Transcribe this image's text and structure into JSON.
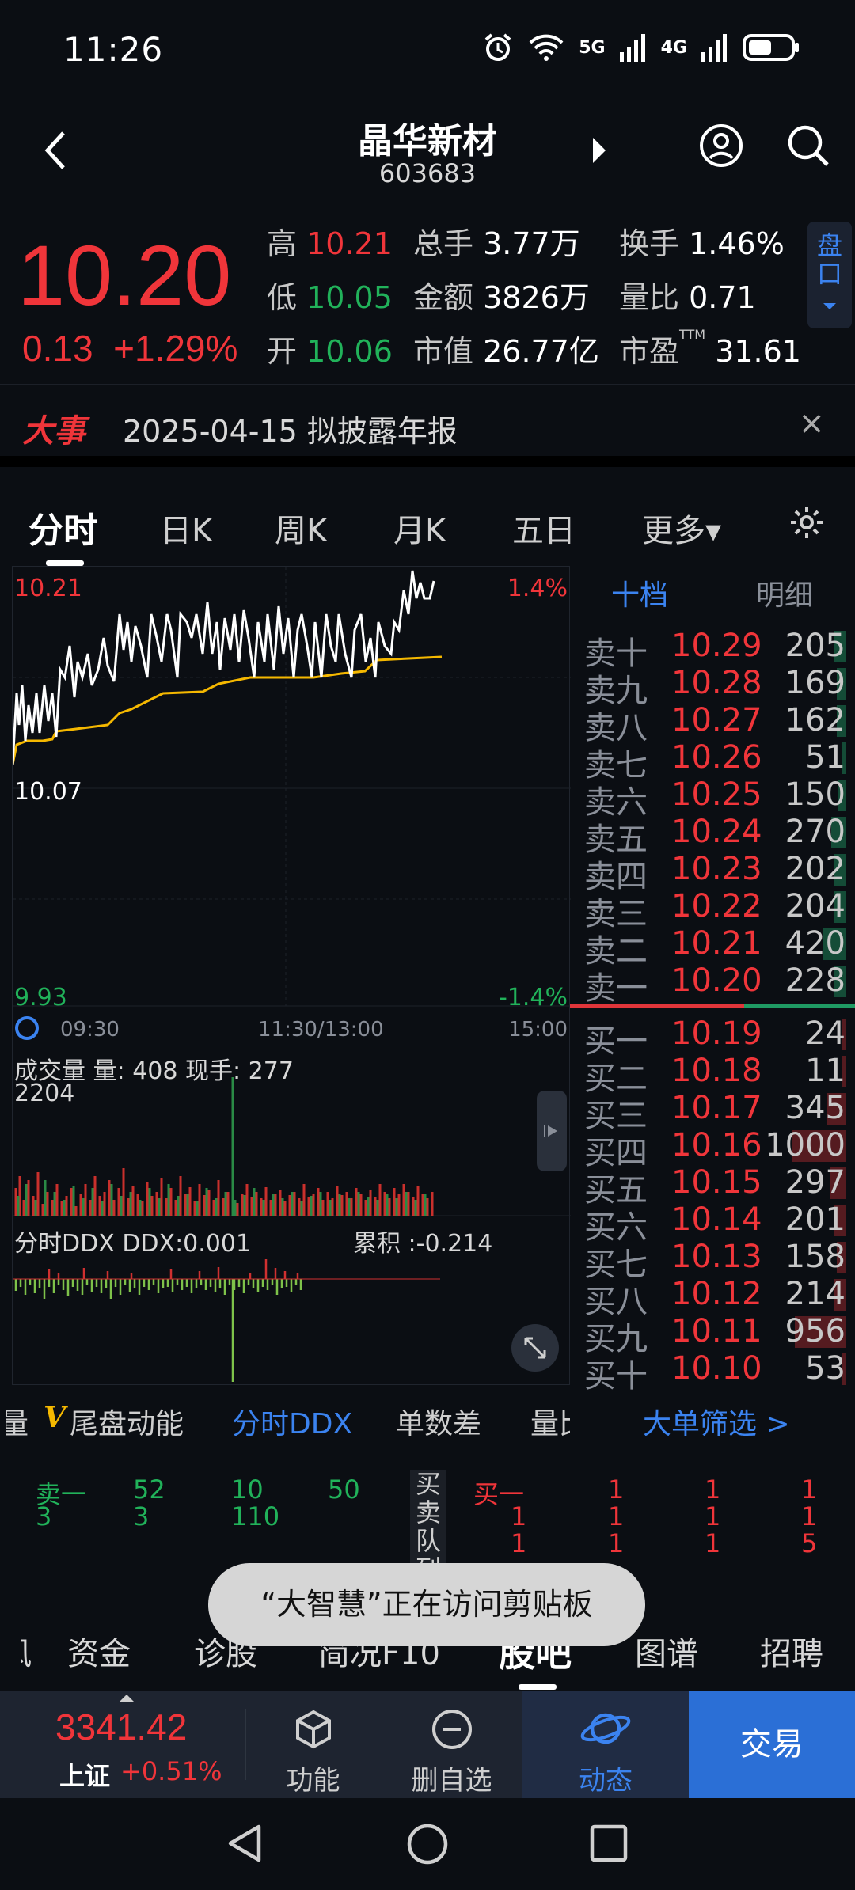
{
  "status_bar": {
    "time": "11:26",
    "signal1": "5G",
    "signal2": "4G"
  },
  "header": {
    "name": "晶华新材",
    "code": "603683"
  },
  "quote": {
    "price": "10.20",
    "change": "0.13",
    "change_pct": "+1.29%",
    "high_label": "高",
    "high": "10.21",
    "low_label": "低",
    "low": "10.05",
    "open_label": "开",
    "open": "10.06",
    "vol_label": "总手",
    "vol": "3.77万",
    "amt_label": "金额",
    "amt": "3826万",
    "cap_label": "市值",
    "cap": "26.77亿",
    "turnover_label": "换手",
    "turnover": "1.46%",
    "ratio_label": "量比",
    "ratio": "0.71",
    "pe_label": "市盈",
    "pe_sup": "TTM",
    "pe": "31.61",
    "pankou": "盘口"
  },
  "news": {
    "tag": "大事",
    "text": "2025-04-15 拟披露年报",
    "close": "×"
  },
  "chart_tabs": [
    {
      "label": "分时"
    },
    {
      "label": "日K"
    },
    {
      "label": "周K"
    },
    {
      "label": "月K"
    },
    {
      "label": "五日"
    },
    {
      "label": "更多▾"
    }
  ],
  "chart": {
    "price_hi": "10.21",
    "price_mid": "10.07",
    "price_lo": "9.93",
    "pct_hi": "1.4%",
    "pct_lo": "-1.4%",
    "time_start": "09:30",
    "time_mid": "11:30/13:00",
    "time_end": "15:00",
    "vol_title": "成交量",
    "vol_amt": "量: 408",
    "vol_now": "现手: 277",
    "vol_max": "2204",
    "ddx_title": "分时DDX",
    "ddx_val": "DDX:0.001",
    "ddx_cum": "累积 :-0.214"
  },
  "orderbook": {
    "tab_active": "十档",
    "tab_other": "明细",
    "asks": [
      {
        "label": "卖十",
        "price": "10.29",
        "vol": "205",
        "frac": 0.1
      },
      {
        "label": "卖九",
        "price": "10.28",
        "vol": "169",
        "frac": 0.08
      },
      {
        "label": "卖八",
        "price": "10.27",
        "vol": "162",
        "frac": 0.08
      },
      {
        "label": "卖七",
        "price": "10.26",
        "vol": "51",
        "frac": 0.03
      },
      {
        "label": "卖六",
        "price": "10.25",
        "vol": "150",
        "frac": 0.07
      },
      {
        "label": "卖五",
        "price": "10.24",
        "vol": "270",
        "frac": 0.13
      },
      {
        "label": "卖四",
        "price": "10.23",
        "vol": "202",
        "frac": 0.1
      },
      {
        "label": "卖三",
        "price": "10.22",
        "vol": "204",
        "frac": 0.1
      },
      {
        "label": "卖二",
        "price": "10.21",
        "vol": "420",
        "frac": 0.2
      },
      {
        "label": "卖一",
        "price": "10.20",
        "vol": "228",
        "frac": 0.11
      }
    ],
    "bids": [
      {
        "label": "买一",
        "price": "10.19",
        "vol": "24",
        "frac": 0.02
      },
      {
        "label": "买二",
        "price": "10.18",
        "vol": "11",
        "frac": 0.01
      },
      {
        "label": "买三",
        "price": "10.17",
        "vol": "345",
        "frac": 0.17
      },
      {
        "label": "买四",
        "price": "10.16",
        "vol": "1000",
        "frac": 0.48
      },
      {
        "label": "买五",
        "price": "10.15",
        "vol": "297",
        "frac": 0.14
      },
      {
        "label": "买六",
        "price": "10.14",
        "vol": "201",
        "frac": 0.1
      },
      {
        "label": "买七",
        "price": "10.13",
        "vol": "158",
        "frac": 0.08
      },
      {
        "label": "买八",
        "price": "10.12",
        "vol": "214",
        "frac": 0.1
      },
      {
        "label": "买九",
        "price": "10.11",
        "vol": "956",
        "frac": 0.46
      },
      {
        "label": "买十",
        "price": "10.10",
        "vol": "53",
        "frac": 0.03
      }
    ]
  },
  "ddx_tabs": {
    "t0": "量",
    "t1": "尾盘动能",
    "t2": "分时DDX",
    "t3": "单数差",
    "t4": "量比",
    "filter": "大单筛选 >"
  },
  "queue": {
    "sell_label": "卖一",
    "sell_row1": [
      "52",
      "10",
      "50"
    ],
    "sell_row2": [
      "3",
      "3",
      "110"
    ],
    "mid_label": "买卖队列",
    "buy_label": "买一",
    "buy_row1": [
      "1",
      "1",
      "1"
    ],
    "buy_row2": [
      "1",
      "1",
      "1",
      "1"
    ],
    "buy_row3": [
      "1",
      "1",
      "1",
      "5"
    ]
  },
  "toast": "“大智慧”正在访问剪贴板",
  "bottom_tabs": [
    "风",
    "资金",
    "诊股",
    "简况F10",
    "股吧",
    "图谱",
    "招聘"
  ],
  "index": {
    "value": "3341.42",
    "name": "上证",
    "pct": "+0.51%"
  },
  "nav": {
    "func": "功能",
    "delete": "删自选",
    "dynamic": "动态",
    "trade": "交易"
  },
  "colors": {
    "up": "#f0353a",
    "down": "#21b25a",
    "accent": "#3b83f0",
    "trade_bg": "#2b6fd6"
  }
}
